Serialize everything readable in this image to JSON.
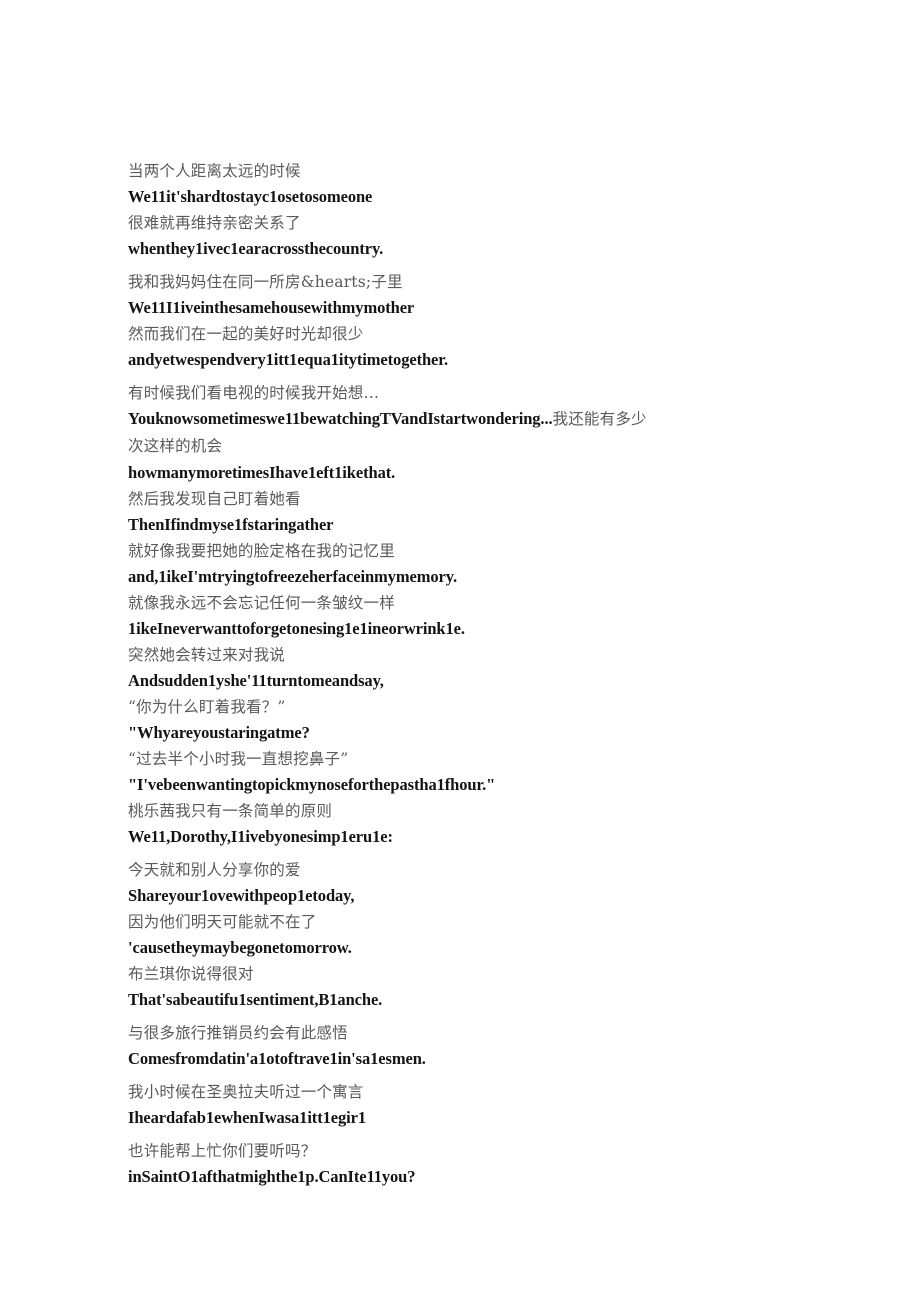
{
  "document": {
    "background_color": "#ffffff",
    "zh_color": "#5a5a5a",
    "en_color": "#141414",
    "stanzas": [
      {
        "id": "stanza-1",
        "spacing": "normal",
        "lines": [
          {
            "lang": "zh",
            "text": "当两个人距离太远的时候"
          },
          {
            "lang": "en",
            "text": "We11it'shardtostayc1osetosomeone"
          },
          {
            "lang": "zh",
            "text": "很难就再维持亲密关系了"
          },
          {
            "lang": "en",
            "text": "whenthey1ivec1earacrossthecountry."
          }
        ]
      },
      {
        "id": "stanza-2",
        "spacing": "normal",
        "lines": [
          {
            "lang": "zh",
            "text": "我和我妈妈住在同一所房&hearts;子里"
          },
          {
            "lang": "en",
            "text": "We11I1iveinthesamehousewithmymother"
          },
          {
            "lang": "zh",
            "text": "然而我们在一起的美好时光却很少"
          },
          {
            "lang": "en",
            "text": "andyetwespendvery1itt1equa1itytimetogether."
          }
        ]
      },
      {
        "id": "stanza-3",
        "spacing": "tight",
        "lines": [
          {
            "lang": "zh",
            "text": "有时候我们看电视的时候我开始想…"
          },
          {
            "lang": "mixed",
            "en_text": "Youknowsometimeswe11bewatchingTVandIstartwondering...",
            "zh_text": "我还能有多少次这样的机会"
          },
          {
            "lang": "en",
            "text": "howmanymoretimesIhave1eft1ikethat."
          },
          {
            "lang": "zh",
            "text": "然后我发现自己盯着她看"
          },
          {
            "lang": "en",
            "text": "ThenIfindmyse1fstaringather"
          },
          {
            "lang": "zh",
            "text": "就好像我要把她的脸定格在我的记忆里"
          },
          {
            "lang": "en",
            "text": "and,1ikeI'mtryingtofreezeherfaceinmymemory."
          },
          {
            "lang": "zh",
            "text": "就像我永远不会忘记任何一条皱纹一样"
          },
          {
            "lang": "en",
            "text": "1ikeIneverwanttoforgetonesing1e1ineorwrink1e."
          },
          {
            "lang": "zh",
            "text": "突然她会转过来对我说"
          },
          {
            "lang": "en",
            "text": "Andsudden1yshe'11turntomeandsay,"
          },
          {
            "lang": "zh",
            "text": "“你为什么盯着我看？”"
          },
          {
            "lang": "en",
            "text": "\"Whyareyoustaringatme?"
          },
          {
            "lang": "zh",
            "text": "“过去半个小时我一直想挖鼻子”"
          },
          {
            "lang": "en",
            "text": "\"I'vebeenwantingtopickmynoseforthepastha1fhour.\""
          }
        ]
      },
      {
        "id": "stanza-4",
        "spacing": "normal",
        "lines": [
          {
            "lang": "zh",
            "text": "桃乐茜我只有一条简单的原则"
          },
          {
            "lang": "en",
            "text": "We11,Dorothy,I1ivebyonesimp1eru1e:"
          }
        ]
      },
      {
        "id": "stanza-5",
        "spacing": "normal",
        "lines": [
          {
            "lang": "zh",
            "text": "今天就和别人分享你的爱"
          },
          {
            "lang": "en",
            "text": "Shareyour1ovewithpeop1etoday,"
          },
          {
            "lang": "zh",
            "text": "因为他们明天可能就不在了"
          },
          {
            "lang": "en",
            "text": "'causetheymaybegonetomorrow."
          },
          {
            "lang": "zh",
            "text": "布兰琪你说得很对"
          },
          {
            "lang": "en",
            "text": "That'sabeautifu1sentiment,B1anche."
          }
        ]
      },
      {
        "id": "stanza-6",
        "spacing": "normal",
        "lines": [
          {
            "lang": "zh",
            "text": "与很多旅行推销员约会有此感悟"
          },
          {
            "lang": "en",
            "text": "Comesfromdatin'a1otoftrave1in'sa1esmen."
          }
        ]
      },
      {
        "id": "stanza-7",
        "spacing": "normal",
        "lines": [
          {
            "lang": "zh",
            "text": "我小时候在圣奥拉夫听过一个寓言"
          },
          {
            "lang": "en",
            "text": "Iheardafab1ewhenIwasa1itt1egir1"
          }
        ]
      },
      {
        "id": "stanza-8",
        "spacing": "normal",
        "lines": [
          {
            "lang": "zh",
            "text": "也许能帮上忙你们要听吗？"
          },
          {
            "lang": "en",
            "text": "inSaintO1afthatmighthe1p.CanIte11you?"
          }
        ]
      }
    ]
  }
}
